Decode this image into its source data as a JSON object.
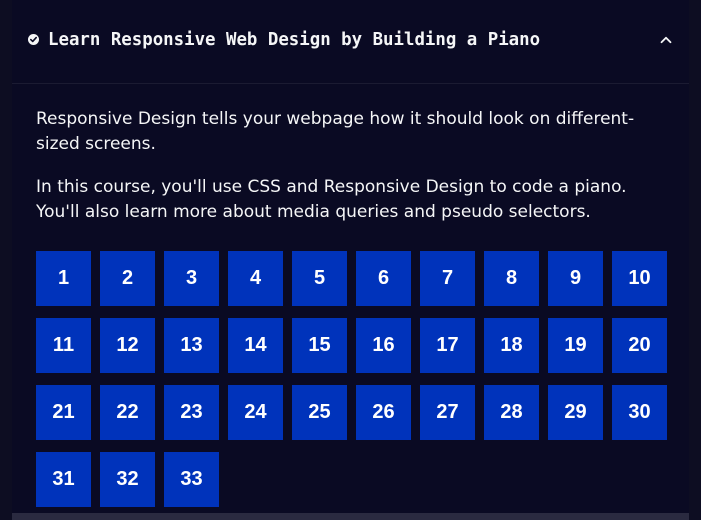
{
  "course": {
    "title": "Learn Responsive Web Design by Building a Piano",
    "completed_icon": "check-circle-icon",
    "toggle_icon": "chevron-up-icon",
    "description": [
      "Responsive Design tells your webpage how it should look on different-sized screens.",
      "In this course, you'll use CSS and Responsive Design to code a piano. You'll also learn more about media queries and pseudo selectors."
    ],
    "steps": [
      "1",
      "2",
      "3",
      "4",
      "5",
      "6",
      "7",
      "8",
      "9",
      "10",
      "11",
      "12",
      "13",
      "14",
      "15",
      "16",
      "17",
      "18",
      "19",
      "20",
      "21",
      "22",
      "23",
      "24",
      "25",
      "26",
      "27",
      "28",
      "29",
      "30",
      "31",
      "32",
      "33"
    ]
  },
  "colors": {
    "background": "#0a0a23",
    "text": "#f5f6f7",
    "step_button": "#0033bb",
    "divider": "#1b1b32"
  }
}
